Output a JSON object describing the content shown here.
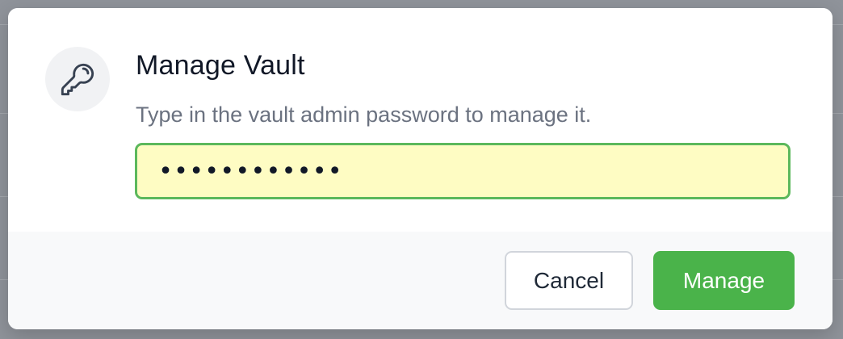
{
  "dialog": {
    "title": "Manage Vault",
    "description": "Type in the vault admin password to manage it.",
    "icon": "key-icon"
  },
  "password_field": {
    "value": "••••••••••••",
    "type": "password",
    "background_color": "#fefcc3",
    "border_color": "#5cb85c"
  },
  "buttons": {
    "cancel_label": "Cancel",
    "manage_label": "Manage",
    "manage_color": "#4ab34a"
  }
}
